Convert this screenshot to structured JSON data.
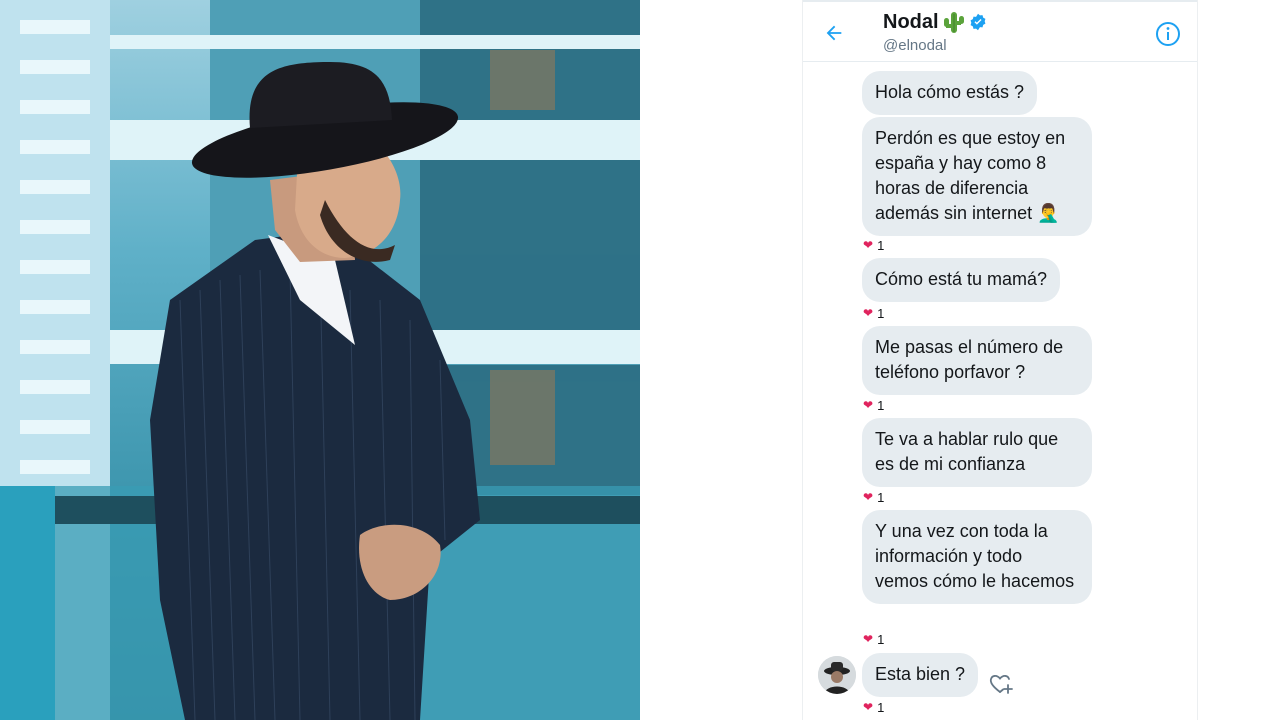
{
  "header": {
    "display_name": "Nodal",
    "handle": "@elnodal",
    "icons": {
      "back": "arrow-left-icon",
      "verified": "verified-badge-icon",
      "emoji": "cactus-emoji",
      "info": "info-icon"
    }
  },
  "messages": [
    {
      "text": "Hola cómo estás ?",
      "reaction": null
    },
    {
      "text": "Perdón es que estoy en españa y hay como 8 horas de diferencia además sin internet 🤦‍♂️",
      "reaction": "1"
    },
    {
      "text": "Cómo está tu mamá?",
      "reaction": "1"
    },
    {
      "text": "Me pasas el número de teléfono porfavor ?",
      "reaction": "1"
    },
    {
      "text": "Te va a hablar rulo que es de mi confianza",
      "reaction": "1"
    },
    {
      "text": "Y una vez con toda la información y todo vemos cómo le hacemos",
      "reaction": "1"
    },
    {
      "text": "Esta bien ?",
      "reaction": "1"
    }
  ],
  "colors": {
    "accent": "#1da1f2",
    "bubble": "#e6ecf0",
    "heart": "#e0245e",
    "text": "#14171a",
    "secondary": "#657786"
  }
}
